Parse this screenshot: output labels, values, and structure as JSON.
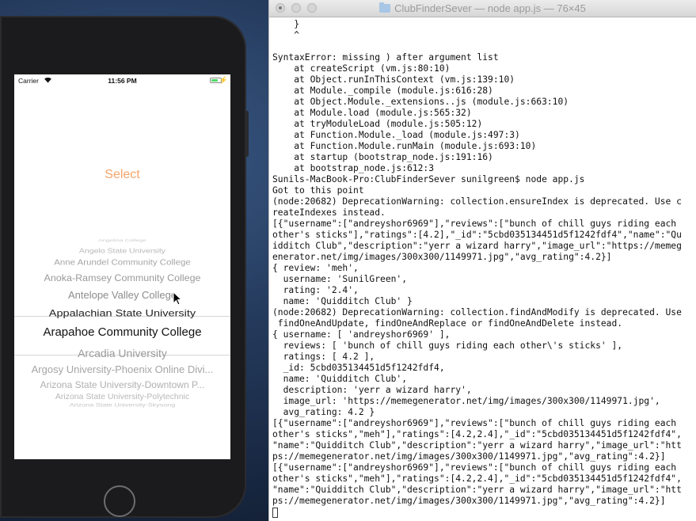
{
  "window": {
    "title": "ClubFinderSever — node app.js — 76×45"
  },
  "phone": {
    "status_bar": {
      "carrier": "Carrier",
      "time": "11:56 PM",
      "battery_level": 0.75
    },
    "select_label": "Select",
    "picker_rows": [
      "Angelina College",
      "Angelo State University",
      "Anne Arundel Community College",
      "Anoka-Ramsey Community College",
      "Antelope Valley College",
      "Appalachian State University",
      "Arapahoe Community College",
      "Arcadia University",
      "Argosy University-Phoenix Online Divi...",
      "Arizona State University-Downtown P...",
      "Arizona State University-Polytechnic",
      "Arizona State University-Skysong"
    ]
  },
  "terminal_lines": [
    "    }",
    "    ^",
    "",
    "SyntaxError: missing ) after argument list",
    "    at createScript (vm.js:80:10)",
    "    at Object.runInThisContext (vm.js:139:10)",
    "    at Module._compile (module.js:616:28)",
    "    at Object.Module._extensions..js (module.js:663:10)",
    "    at Module.load (module.js:565:32)",
    "    at tryModuleLoad (module.js:505:12)",
    "    at Function.Module._load (module.js:497:3)",
    "    at Function.Module.runMain (module.js:693:10)",
    "    at startup (bootstrap_node.js:191:16)",
    "    at bootstrap_node.js:612:3",
    "Sunils-MacBook-Pro:ClubFinderSever sunilgreen$ node app.js",
    "Got to this point",
    "(node:20682) DeprecationWarning: collection.ensureIndex is deprecated. Use c",
    "reateIndexes instead.",
    "[{\"username\":[\"andreyshor6969\"],\"reviews\":[\"bunch of chill guys riding each",
    "other's sticks\"],\"ratings\":[4.2],\"_id\":\"5cbd035134451d5f1242fdf4\",\"name\":\"Qu",
    "idditch Club\",\"description\":\"yerr a wizard harry\",\"image_url\":\"https://memeg",
    "enerator.net/img/images/300x300/1149971.jpg\",\"avg_rating\":4.2}]",
    "{ review: 'meh',",
    "  username: 'SunilGreen',",
    "  rating: '2.4',",
    "  name: 'Quidditch Club' }",
    "(node:20682) DeprecationWarning: collection.findAndModify is deprecated. Use",
    " findOneAndUpdate, findOneAndReplace or findOneAndDelete instead.",
    "{ username: [ 'andreyshor6969' ],",
    "  reviews: [ 'bunch of chill guys riding each other\\'s sticks' ],",
    "  ratings: [ 4.2 ],",
    "  _id: 5cbd035134451d5f1242fdf4,",
    "  name: 'Quidditch Club',",
    "  description: 'yerr a wizard harry',",
    "  image_url: 'https://memegenerator.net/img/images/300x300/1149971.jpg',",
    "  avg_rating: 4.2 }",
    "[{\"username\":[\"andreyshor6969\"],\"reviews\":[\"bunch of chill guys riding each",
    "other's sticks\",\"meh\"],\"ratings\":[4.2,2.4],\"_id\":\"5cbd035134451d5f1242fdf4\",",
    "\"name\":\"Quidditch Club\",\"description\":\"yerr a wizard harry\",\"image_url\":\"htt",
    "ps://memegenerator.net/img/images/300x300/1149971.jpg\",\"avg_rating\":4.2}]",
    "[{\"username\":[\"andreyshor6969\"],\"reviews\":[\"bunch of chill guys riding each",
    "other's sticks\",\"meh\"],\"ratings\":[4.2,2.4],\"_id\":\"5cbd035134451d5f1242fdf4\",",
    "\"name\":\"Quidditch Club\",\"description\":\"yerr a wizard harry\",\"image_url\":\"htt",
    "ps://memegenerator.net/img/images/300x300/1149971.jpg\",\"avg_rating\":4.2}]"
  ]
}
